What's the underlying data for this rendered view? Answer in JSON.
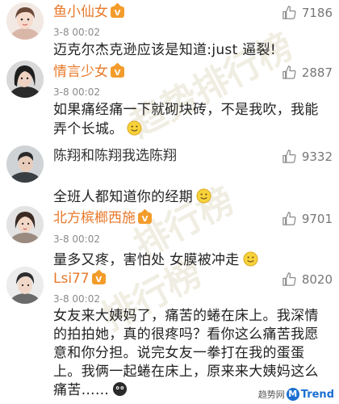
{
  "comments": [
    {
      "user": "鱼小仙女",
      "likes": "7186",
      "time": "3-8 00:02",
      "text": "迈克尔杰克逊应该是知道:just 逼裂!",
      "emoji": ""
    },
    {
      "user": "情言少女",
      "likes": "2887",
      "time": "3-8 00:02",
      "text": "如果痛经痛一下就砌块砖，不是我吹，我能弄个长城。",
      "emoji": "smile-emoji"
    },
    {
      "user": "陈翔和陈翔我选陈翔",
      "likes": "9332",
      "time": "",
      "text": "全班人都知道你的经期",
      "emoji": "smile-emoji"
    },
    {
      "user": "北方槟榔西施",
      "likes": "9701",
      "time": "3-8 00:02",
      "text": "量多又疼，害怕处 女膜被冲走",
      "emoji": "smile-emoji"
    },
    {
      "user": "Lsi77",
      "likes": "8020",
      "time": "3-8 00:02",
      "text": "女友来大姨妈了，痛苦的蜷在床上。我深情的拍拍她，真的很疼吗？看你这么痛苦我愿意和你分担。说完女友一拳打在我的蛋蛋上。我俩一起蜷在床上，原来来大姨妈这么痛苦……",
      "emoji": "dark-emoji"
    }
  ],
  "watermarks": [
    "趋势排行榜",
    "排行榜"
  ],
  "brand": {
    "prefix": "趋势网",
    "m": "M",
    "name": "Trend"
  },
  "colors": {
    "orange_name": "#e8792a",
    "vip_badge": "#f39c2b",
    "brand_blue": "#1a6fd0"
  }
}
